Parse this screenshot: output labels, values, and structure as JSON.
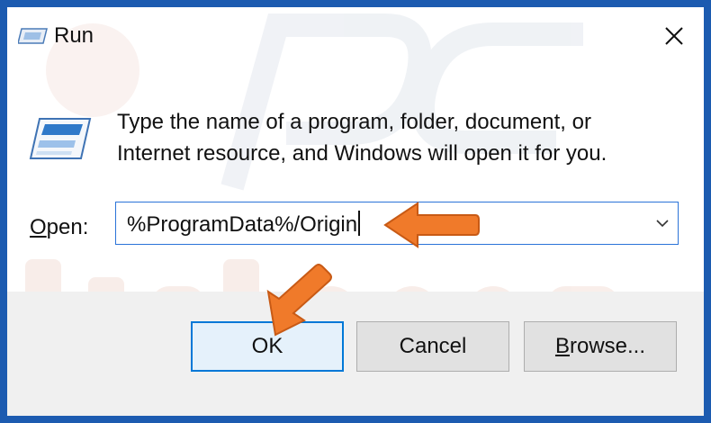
{
  "window": {
    "title": "Run",
    "title_icon": "run-icon",
    "close_icon": "close-icon"
  },
  "dialog": {
    "icon": "run-program-icon",
    "description_line1": "Type the name of a program, folder, document, or",
    "description_line2": "Internet resource, and Windows will open it for you.",
    "open_label_accel": "O",
    "open_label_rest": "pen:",
    "open_value": "%ProgramData%/Origin"
  },
  "buttons": {
    "ok": "OK",
    "cancel": "Cancel",
    "browse_accel": "B",
    "browse_rest": "rowse..."
  },
  "colors": {
    "frame": "#1c5bb0",
    "accent": "#0078d7",
    "annotation_arrow": "#f07a2a"
  }
}
